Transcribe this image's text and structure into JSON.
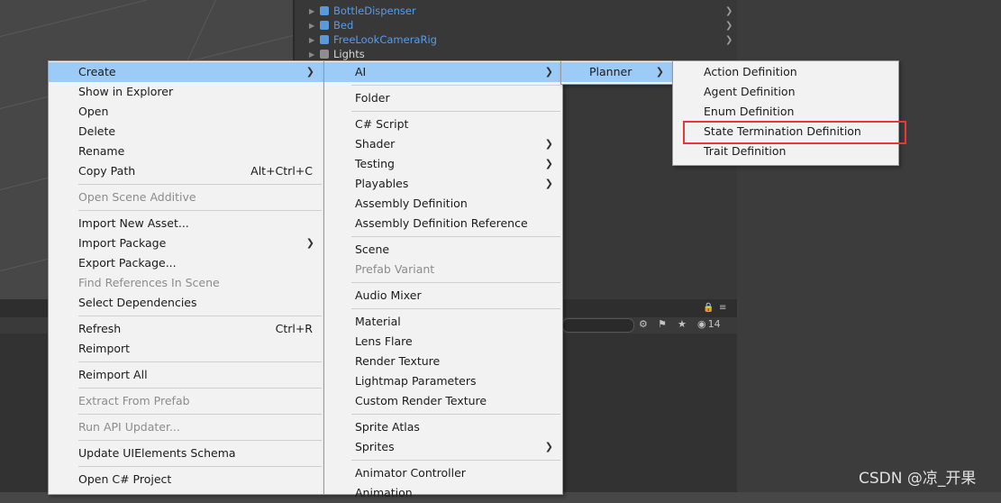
{
  "hierarchy": {
    "items": [
      {
        "name": "BottleDispenser",
        "icon": "prefab-cube-icon"
      },
      {
        "name": "Bed",
        "icon": "prefab-cube-icon"
      },
      {
        "name": "FreeLookCameraRig",
        "icon": "prefab-cube-icon"
      },
      {
        "name": "Lights",
        "icon": "gameobject-cube-icon"
      }
    ]
  },
  "toolbar": {
    "visible_count": "14"
  },
  "main_menu": {
    "items": [
      {
        "label": "Create",
        "submenu": true,
        "highlighted": true
      },
      {
        "label": "Show in Explorer"
      },
      {
        "label": "Open"
      },
      {
        "label": "Delete"
      },
      {
        "label": "Rename"
      },
      {
        "label": "Copy Path",
        "shortcut": "Alt+Ctrl+C"
      },
      {
        "separator": true
      },
      {
        "label": "Open Scene Additive",
        "disabled": true
      },
      {
        "separator": true
      },
      {
        "label": "Import New Asset..."
      },
      {
        "label": "Import Package",
        "submenu": true
      },
      {
        "label": "Export Package..."
      },
      {
        "label": "Find References In Scene",
        "disabled": true
      },
      {
        "label": "Select Dependencies"
      },
      {
        "separator": true
      },
      {
        "label": "Refresh",
        "shortcut": "Ctrl+R"
      },
      {
        "label": "Reimport"
      },
      {
        "separator": true
      },
      {
        "label": "Reimport All"
      },
      {
        "separator": true
      },
      {
        "label": "Extract From Prefab",
        "disabled": true
      },
      {
        "separator": true
      },
      {
        "label": "Run API Updater...",
        "disabled": true
      },
      {
        "separator": true
      },
      {
        "label": "Update UIElements Schema"
      },
      {
        "separator": true
      },
      {
        "label": "Open C# Project"
      }
    ]
  },
  "create_menu": {
    "items": [
      {
        "label": "AI",
        "submenu": true,
        "highlighted": true
      },
      {
        "separator": true
      },
      {
        "label": "Folder"
      },
      {
        "separator": true
      },
      {
        "label": "C# Script"
      },
      {
        "label": "Shader",
        "submenu": true
      },
      {
        "label": "Testing",
        "submenu": true
      },
      {
        "label": "Playables",
        "submenu": true
      },
      {
        "label": "Assembly Definition"
      },
      {
        "label": "Assembly Definition Reference"
      },
      {
        "separator": true
      },
      {
        "label": "Scene"
      },
      {
        "label": "Prefab Variant",
        "disabled": true
      },
      {
        "separator": true
      },
      {
        "label": "Audio Mixer"
      },
      {
        "separator": true
      },
      {
        "label": "Material"
      },
      {
        "label": "Lens Flare"
      },
      {
        "label": "Render Texture"
      },
      {
        "label": "Lightmap Parameters"
      },
      {
        "label": "Custom Render Texture"
      },
      {
        "separator": true
      },
      {
        "label": "Sprite Atlas"
      },
      {
        "label": "Sprites",
        "submenu": true
      },
      {
        "separator": true
      },
      {
        "label": "Animator Controller"
      },
      {
        "label": "Animation"
      }
    ]
  },
  "ai_menu": {
    "items": [
      {
        "label": "Planner",
        "submenu": true,
        "highlighted": true
      }
    ]
  },
  "planner_menu": {
    "items": [
      {
        "label": "Action Definition"
      },
      {
        "label": "Agent Definition"
      },
      {
        "label": "Enum Definition"
      },
      {
        "label": "State Termination Definition",
        "outlined": true
      },
      {
        "label": "Trait Definition"
      }
    ]
  },
  "colors": {
    "highlight": "#9ccbf8",
    "menu_bg": "#f2f2f2",
    "outline_red": "#e53935",
    "hierarchy_link": "#5b9be5"
  },
  "watermark": "CSDN @凉_开果"
}
